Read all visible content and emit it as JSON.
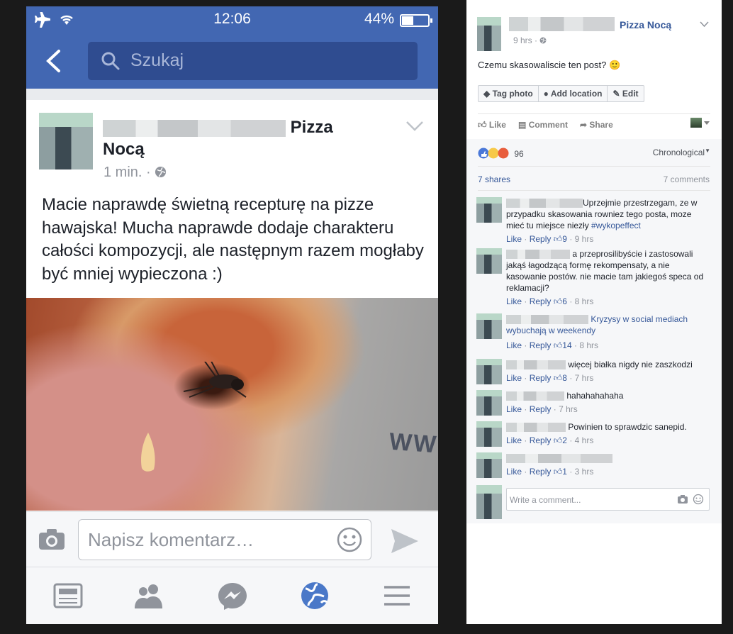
{
  "phone": {
    "status": {
      "time": "12:06",
      "battery": "44%"
    },
    "search": {
      "placeholder": "Szukaj"
    },
    "post": {
      "author_suffix": "Pizza",
      "author_line2": "Nocą",
      "time": "1 min.",
      "sep": "·",
      "text": "Macie naprawdę świetną recepturę na pizze hawajska! Mucha naprawde dodaje charakteru całości kompozycji, ale następnym razem mogłaby być mniej wypieczona :)",
      "photo_text": "WW"
    },
    "composer": {
      "placeholder": "Napisz komentarz…"
    },
    "tabs": [
      "news-feed-icon",
      "friends-icon",
      "messenger-icon",
      "globe-icon",
      "menu-icon"
    ]
  },
  "desktop": {
    "post": {
      "page_name": "Pizza Nocą",
      "time": "9 hrs",
      "sep": "·",
      "text": "Czemu skasowaliscie ten post? 🙂",
      "tools": [
        "Tag photo",
        "Add location",
        "Edit"
      ],
      "actions": {
        "like": "Like",
        "comment": "Comment",
        "share": "Share"
      }
    },
    "ufi": {
      "reactions_count": "96",
      "order": "Chronological",
      "shares": "7 shares",
      "comments_count": "7 comments",
      "comments": [
        {
          "text": "Uprzejmie przestrzegam, ze w przypadku skasowania rowniez tego posta, moze mieć tu miejsce niezły ",
          "hashtag": "#wykopeffect",
          "likes": "9",
          "time": "9 hrs"
        },
        {
          "text": "a przeprosilibyście i zastosowali jakąś łagodzącą formę rekompensaty, a nie kasowanie postów. nie macie tam jakiegoś speca od reklamacji?",
          "hashtag": "",
          "likes": "6",
          "time": "8 hrs"
        },
        {
          "text": "",
          "hashtag": "Kryzysy w social mediach wybuchają w weekendy",
          "likes": "14",
          "time": "8 hrs"
        },
        {
          "text": "więcej białka nigdy nie zaszkodzi",
          "hashtag": "",
          "likes": "8",
          "time": "7 hrs"
        },
        {
          "text": "hahahahahaha",
          "hashtag": "",
          "likes": "",
          "time": "7 hrs"
        },
        {
          "text": "Powinien to sprawdzic sanepid.",
          "hashtag": "",
          "likes": "2",
          "time": "4 hrs"
        },
        {
          "text": "",
          "hashtag": "",
          "likes": "1",
          "time": "3 hrs"
        }
      ],
      "like_label": "Like",
      "reply_label": "Reply",
      "dot": "·",
      "write_placeholder": "Write a comment..."
    }
  }
}
